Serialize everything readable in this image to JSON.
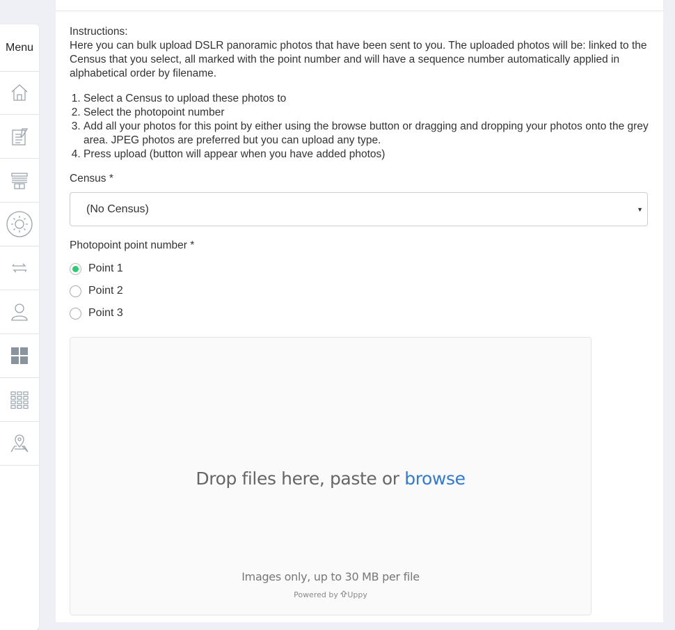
{
  "sidebar": {
    "menu_label": "Menu",
    "items": [
      {
        "icon": "home-icon"
      },
      {
        "icon": "edit-document-icon"
      },
      {
        "icon": "stack-icon"
      },
      {
        "icon": "sun-icon"
      },
      {
        "icon": "transfer-arrows-icon"
      },
      {
        "icon": "user-icon"
      },
      {
        "icon": "dashboard-grid-icon"
      },
      {
        "icon": "apps-grid-icon"
      },
      {
        "icon": "map-pin-icon"
      }
    ]
  },
  "instructions": {
    "title": "Instructions:",
    "text": "Here you can bulk upload DSLR panoramic photos that have been sent to you. The uploaded photos will be: linked to the Census that you select, all marked with the point number and will have a sequence number automatically applied in alphabetical order by filename.",
    "steps": [
      "Select a Census to upload these photos to",
      "Select the photopoint number",
      "Add all your photos for this point by either using the browse button or dragging and dropping your photos onto the grey area. JPEG photos are preferred but you can upload any type.",
      "Press upload (button will appear when you have added photos)"
    ]
  },
  "census": {
    "label": "Census *",
    "selected": "(No Census)"
  },
  "photopoint": {
    "label": "Photopoint point number *",
    "options": [
      "Point 1",
      "Point 2",
      "Point 3"
    ],
    "selected_index": 0
  },
  "dropzone": {
    "text_prefix": "Drop files here, paste or",
    "browse_label": "browse",
    "note": "Images only, up to 30 MB per file",
    "powered_by": "Powered by",
    "brand": "Uppy"
  },
  "colors": {
    "accent": "#2f7bd6",
    "radio_checked": "#2ecc71"
  }
}
